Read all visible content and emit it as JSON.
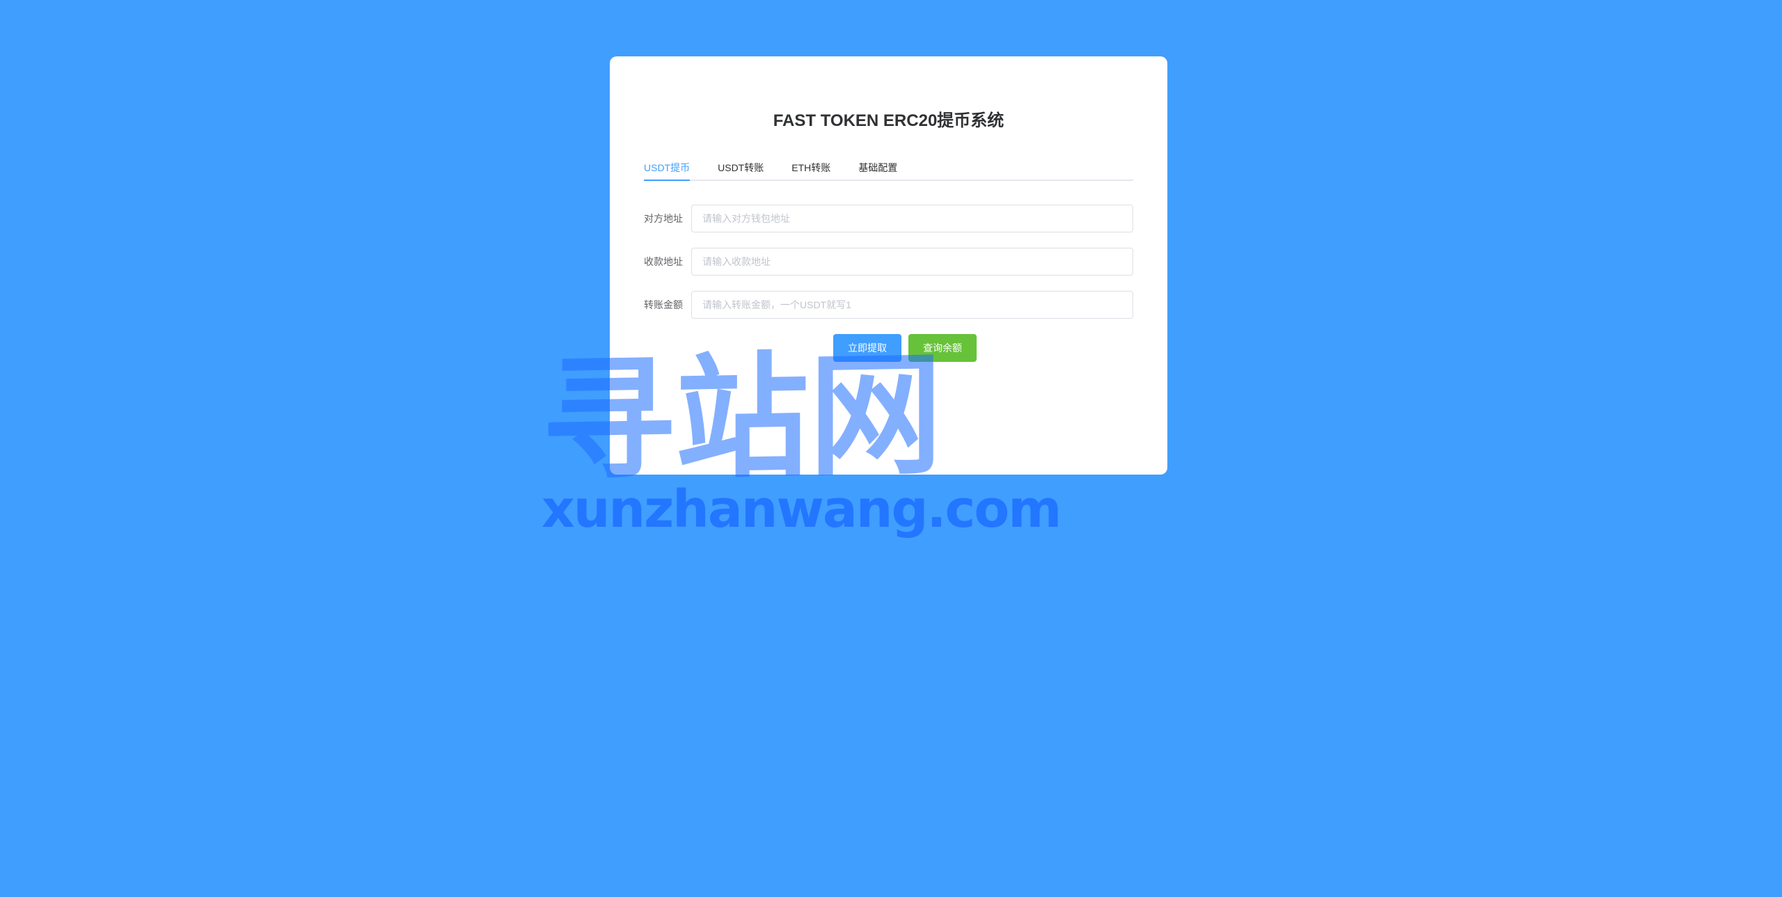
{
  "title": "FAST TOKEN ERC20提币系统",
  "tabs": [
    {
      "label": "USDT提币",
      "active": true
    },
    {
      "label": "USDT转账",
      "active": false
    },
    {
      "label": "ETH转账",
      "active": false
    },
    {
      "label": "基础配置",
      "active": false
    }
  ],
  "form": {
    "recipient": {
      "label": "对方地址",
      "placeholder": "请输入对方钱包地址",
      "value": ""
    },
    "receive": {
      "label": "收款地址",
      "placeholder": "请输入收款地址",
      "value": ""
    },
    "amount": {
      "label": "转账金额",
      "placeholder": "请输入转账金额，一个USDT就写1",
      "value": ""
    }
  },
  "buttons": {
    "withdraw": "立即提取",
    "balance": "查询余额"
  },
  "colors": {
    "background": "#409eff",
    "primary": "#409eff",
    "success": "#67c23a"
  },
  "watermark": {
    "cn": "寻站网",
    "en": "xunzhanwang.com"
  }
}
